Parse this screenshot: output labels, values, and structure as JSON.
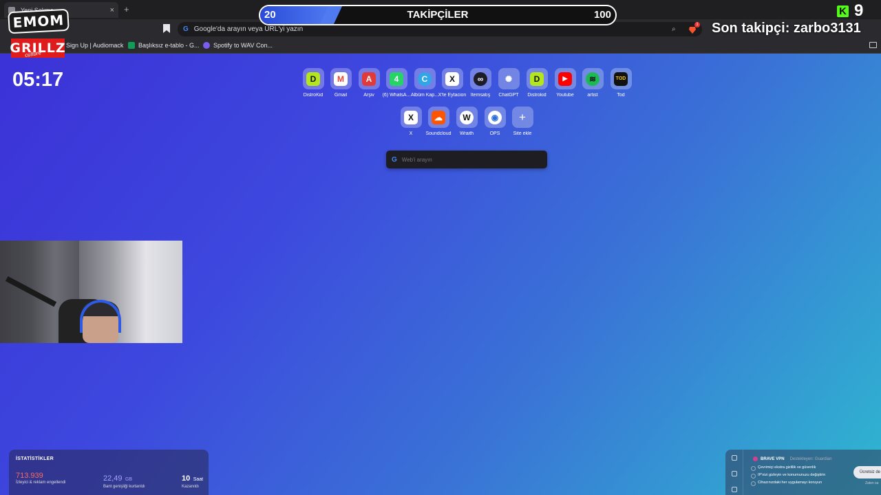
{
  "browser": {
    "tab_title": "Yeni Sekme",
    "tab_close": "×",
    "new_tab": "+",
    "omnibox_placeholder": "Google'da arayın veya URL'yi yazın",
    "brave_badge": "1",
    "bookmarks": [
      {
        "label": "Sign Up | Audiomack",
        "icon_color": "#ffa200"
      },
      {
        "label": "Başlıksız e-tablo - G...",
        "icon_color": "#0f9d58"
      },
      {
        "label": "Spotify to WAV Con...",
        "icon_color": "#7b5cf0"
      }
    ]
  },
  "overlay": {
    "emom_logo": "EMOM",
    "grillz_logo": "GRILLZ",
    "grillz_sub": "culture",
    "followers_title": "TAKİPÇİLER",
    "followers_current": "20",
    "followers_goal": "100",
    "followers_progress": 0.2,
    "kick_count": "9",
    "kick_logo": "K",
    "last_follower": "Son takipçi: zarbo3131",
    "clock": "05:17"
  },
  "shortcuts_row1": [
    {
      "label": "DistroKid",
      "glyph": "D",
      "color": "#b4e61e",
      "icon": "distrokid-icon"
    },
    {
      "label": "Gmail",
      "glyph": "M",
      "color": "#e94335",
      "icon": "gmail-icon"
    },
    {
      "label": "Arşiv",
      "glyph": "A",
      "color": "#e03a3a",
      "icon": "archive-icon"
    },
    {
      "label": "(6) WhatsA...",
      "glyph": "4",
      "color": "#25d366",
      "icon": "whatsapp-icon"
    },
    {
      "label": "Albüm Kap...",
      "glyph": "C",
      "color": "#2ea6e8",
      "icon": "canva-icon"
    },
    {
      "label": "X'te Eytacion",
      "glyph": "X",
      "color": "#111111",
      "icon": "x-icon"
    },
    {
      "label": "İtemsatış",
      "glyph": "∞",
      "color": "#1d1d2a",
      "icon": "itemsatis-icon"
    },
    {
      "label": "ChatGPT",
      "glyph": "✺",
      "color": "#74aa9c",
      "icon": "chatgpt-icon"
    },
    {
      "label": "Distrokid",
      "glyph": "D",
      "color": "#b4e61e",
      "icon": "distrokid-icon"
    },
    {
      "label": "Youtube",
      "glyph": "▶",
      "color": "#ff0000",
      "icon": "youtube-icon"
    },
    {
      "label": "artist",
      "glyph": "≋",
      "color": "#1db954",
      "icon": "spotify-icon"
    },
    {
      "label": "Tod",
      "glyph": "TOD",
      "color": "#111111",
      "icon": "tod-icon"
    }
  ],
  "shortcuts_row2": [
    {
      "label": "X",
      "glyph": "X",
      "color": "#111111",
      "icon": "x-icon"
    },
    {
      "label": "Soundcloud",
      "glyph": "☁",
      "color": "#ff5500",
      "icon": "soundcloud-icon"
    },
    {
      "label": "Wraith",
      "glyph": "W",
      "color": "#111111",
      "icon": "wraith-icon"
    },
    {
      "label": "OPS",
      "glyph": "◉",
      "color": "#2b6fd6",
      "icon": "ops-icon"
    },
    {
      "label": "Site ekle",
      "glyph": "+",
      "color": "transparent",
      "icon": "add-icon"
    }
  ],
  "search": {
    "placeholder": "Web'i arayın"
  },
  "stats": {
    "header": "İSTATİSTİKLER",
    "blocked_value": "713.939",
    "blocked_desc": "İzleyici & reklam engellendi",
    "bandwidth_value": "22,49",
    "bandwidth_unit": "GB",
    "bandwidth_desc": "Bant genişliği kurtarıldı",
    "time_value": "10",
    "time_unit": "Saat",
    "time_desc": "Kazanıldı"
  },
  "vpn": {
    "title": "BRAVE VPN",
    "sponsor": "Destekleyen: Guardian",
    "features": [
      "Çevrimiçi ekstra gizlilik ve güvenlik",
      "IP'nizi gizleyin ve konumunuzu değiştirin",
      "Cihazınızdaki her uygulamayı koruyun"
    ],
    "cta": "Ücretsiz de",
    "more": "Zaten sa"
  },
  "colors": {
    "progress_fill": "#4f7af0",
    "kick_green": "#53fc18",
    "blocked_value": "#ff6b5b",
    "bandwidth_value": "#a6a2ff"
  }
}
